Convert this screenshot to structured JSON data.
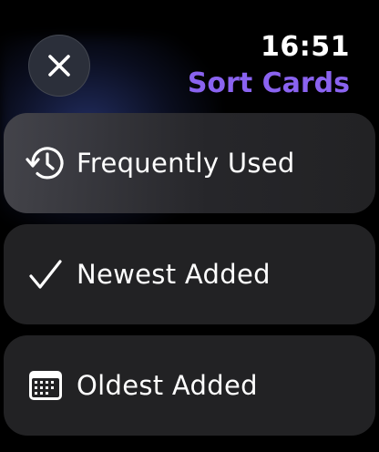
{
  "status": {
    "time": "16:51"
  },
  "header": {
    "title": "Sort Cards",
    "title_color": "#8a63f0",
    "close_icon": "close-icon"
  },
  "options": [
    {
      "label": "Frequently Used",
      "icon": "history-icon"
    },
    {
      "label": "Newest Added",
      "icon": "checkmark-icon",
      "selected": true
    },
    {
      "label": "Oldest Added",
      "icon": "calendar-icon"
    }
  ]
}
